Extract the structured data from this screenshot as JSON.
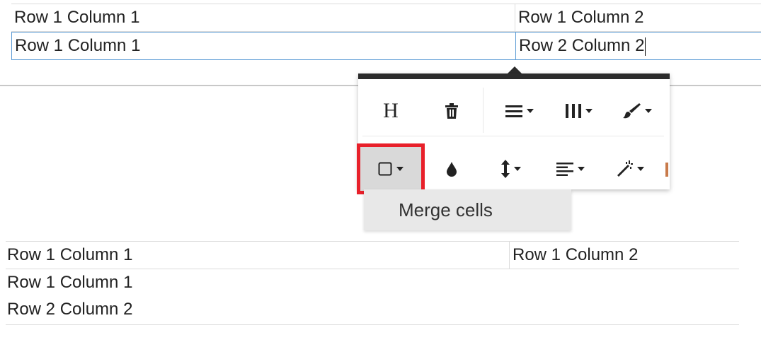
{
  "top_table": {
    "rows": [
      [
        "Row 1 Column 1",
        "Row 1 Column 2"
      ],
      [
        "Row 1 Column 1",
        "Row 2 Column 2"
      ]
    ]
  },
  "toolbar": {
    "buttons": [
      {
        "name": "heading-button",
        "label": "H"
      },
      {
        "name": "delete-table-button",
        "icon": "trash-icon"
      },
      {
        "name": "row-menu-button",
        "icon": "rows-icon"
      },
      {
        "name": "column-menu-button",
        "icon": "columns-icon"
      },
      {
        "name": "style-menu-button",
        "icon": "paintbrush-icon"
      },
      {
        "name": "cell-menu-button",
        "icon": "square-icon",
        "active": true
      },
      {
        "name": "background-color-button",
        "icon": "droplet-icon"
      },
      {
        "name": "vertical-align-button",
        "icon": "vertical-arrows-icon"
      },
      {
        "name": "horizontal-align-button",
        "icon": "align-left-icon"
      },
      {
        "name": "advanced-style-button",
        "icon": "magic-wand-icon"
      }
    ],
    "highlight_color": "#e8202a"
  },
  "cell_menu": {
    "items": [
      {
        "label": "Merge cells"
      }
    ]
  },
  "bottom_table": {
    "row1": [
      "Row 1 Column 1",
      "Row 1 Column 2"
    ],
    "merged_lines": [
      "Row 1 Column 1",
      "Row 2 Column 2"
    ]
  },
  "colors": {
    "selection_border": "#5b9bd5",
    "toolbar_top_bar": "#2b2b2b",
    "menu_background": "#e8e8e8"
  }
}
